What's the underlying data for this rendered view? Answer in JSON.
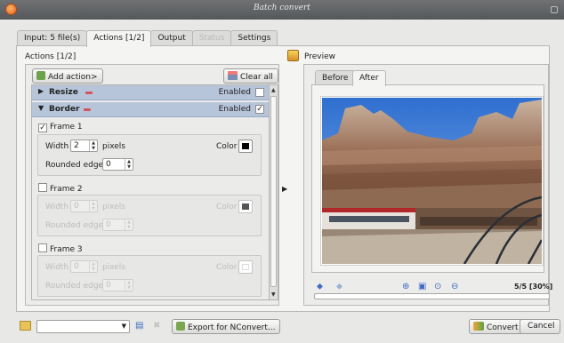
{
  "window": {
    "title": "Batch convert"
  },
  "tabs": [
    {
      "label": "Input: 5 file(s)",
      "active": false,
      "disabled": false
    },
    {
      "label": "Actions [1/2]",
      "active": true,
      "disabled": false
    },
    {
      "label": "Output",
      "active": false,
      "disabled": false
    },
    {
      "label": "Status",
      "active": false,
      "disabled": true
    },
    {
      "label": "Settings",
      "active": false,
      "disabled": false
    }
  ],
  "actions_panel": {
    "title": "Actions [1/2]",
    "add_button": "Add action>",
    "clear_button": "Clear all",
    "actions": [
      {
        "name": "Resize",
        "expanded": false,
        "enabled_label": "Enabled",
        "enabled": false
      },
      {
        "name": "Border",
        "expanded": true,
        "enabled_label": "Enabled",
        "enabled": true
      }
    ],
    "frames": [
      {
        "label": "Frame 1",
        "checked": true,
        "width_label": "Width",
        "width": "2",
        "unit": "pixels",
        "color_label": "Color",
        "color": "#000000",
        "rounded_label": "Rounded edge",
        "rounded": "0"
      },
      {
        "label": "Frame 2",
        "checked": false,
        "width_label": "Width",
        "width": "0",
        "unit": "pixels",
        "color_label": "Color",
        "color": "#555555",
        "rounded_label": "Rounded edge",
        "rounded": "0"
      },
      {
        "label": "Frame 3",
        "checked": false,
        "width_label": "Width",
        "width": "0",
        "unit": "pixels",
        "color_label": "Color",
        "color": "#ffffff",
        "rounded_label": "Rounded edge",
        "rounded": "0"
      }
    ]
  },
  "preview": {
    "title": "Preview",
    "tabs": [
      {
        "label": "Before",
        "active": false
      },
      {
        "label": "After",
        "active": true
      }
    ],
    "counter": "5/5 [30%]",
    "progress": 0
  },
  "bottom": {
    "export_button": "Export for NConvert...",
    "convert_button": "Convert",
    "cancel_button": "Cancel"
  },
  "icons": {
    "app": "app-logo-icon",
    "add": "add-action-icon",
    "clear": "clear-all-icon",
    "prev": "prev-arrow-icon",
    "next": "next-arrow-icon",
    "zoom_in": "zoom-in-icon",
    "fit": "fit-window-icon",
    "zoom_100": "zoom-original-icon",
    "zoom_out": "zoom-out-icon",
    "save": "save-icon",
    "delete": "delete-icon",
    "folder": "folder-icon"
  }
}
